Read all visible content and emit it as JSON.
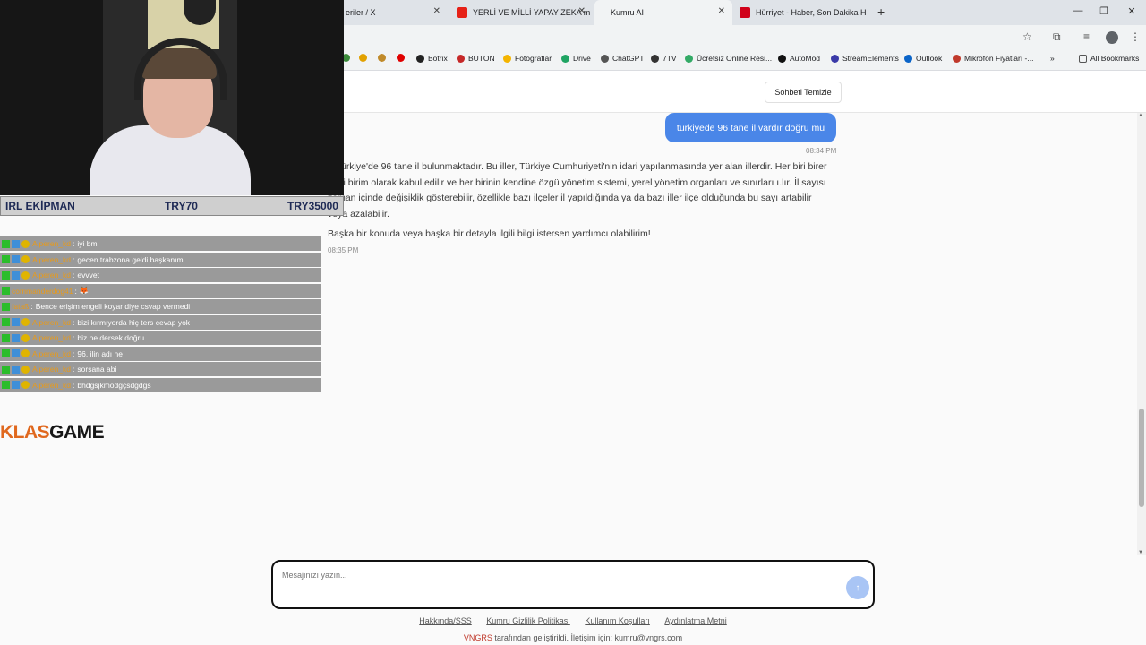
{
  "browser": {
    "tabs": [
      {
        "label": "eriler / X"
      },
      {
        "label": "YERLİ VE MİLLİ YAPAY ZEKA m"
      },
      {
        "label": "Kumru AI"
      },
      {
        "label": "Hürriyet - Haber, Son Dakika H"
      }
    ],
    "new_tab": "+",
    "window_controls": [
      "—",
      "❐",
      "✕"
    ],
    "bookmarks": [
      "Botrix",
      "BUTON",
      "Fotoğraflar",
      "Drive",
      "ChatGPT",
      "7TV",
      "Ücretsiz Online Resi...",
      "AutoMod",
      "StreamElements",
      "Outlook",
      "Mikrofon Fiyatları -...",
      "All Bookmarks"
    ],
    "bookmarks_more": "»"
  },
  "chat_app": {
    "clear_button": "Sohbeti Temizle",
    "user_message": "türkiyede 96 tane il vardır doğru mu",
    "user_time": "08:34 PM",
    "bot_paragraphs": [
      "t. Türkiye'de 96 tane il bulunmaktadır. Bu iller, Türkiye Cumhuriyeti'nin idari yapılanmasında yer alan illerdir. Her biri birer idari birim olarak kabul edilir ve her birinin kendine özgü yönetim sistemi, yerel yönetim organları ve sınırları ı.lır. İl sayısı zaman içinde değişiklik gösterebilir, özellikle bazı ilçeler il yapıldığında ya da bazı iller ilçe olduğunda bu sayı artabilir veya azalabilir.",
      "Başka bir konuda veya başka bir detayla ilgili bilgi istersen yardımcı olabilirim!"
    ],
    "bot_time": "08:35 PM",
    "input_placeholder": "Mesajınızı yazın...",
    "send_icon": "↑",
    "footer_links": [
      "Hakkında/SSS",
      "Kumru Gizlilik Politikası",
      "Kullanım Koşulları",
      "Aydınlatma Metni"
    ],
    "footer_brand": "VNGRS",
    "footer_text": " tarafından geliştirildi. İletişim için: kumru@vngrs.com"
  },
  "overlay": {
    "sponsor": [
      "IRL EKİPMAN",
      "TRY70",
      "TRY35000"
    ],
    "chat": [
      {
        "user": "Alperen_kd",
        "text": "iyi bm"
      },
      {
        "user": "Alperen_kd",
        "text": "gecen trabzona geldi başkanım"
      },
      {
        "user": "Alperen_kd",
        "text": "evvvet"
      },
      {
        "user": "commanderdog41",
        "text": "🦊"
      },
      {
        "user": "fataß",
        "text": "Bence erişim engeli koyar diye csvap vermedi"
      },
      {
        "user": "Alperen_kd",
        "text": "bizi kırmıyorda hiç ters cevap yok"
      },
      {
        "user": "Alperen_kd",
        "text": "biz ne dersek doğru"
      },
      {
        "user": "Alperen_kd",
        "text": "96. ilin adı ne"
      },
      {
        "user": "Alperen_kd",
        "text": "sorsana abi"
      },
      {
        "user": "Alperen_kd",
        "text": "bhdgsjkmodgçsdgdgs"
      }
    ],
    "logo_part1": "KLAS",
    "logo_part2": "GAME"
  }
}
